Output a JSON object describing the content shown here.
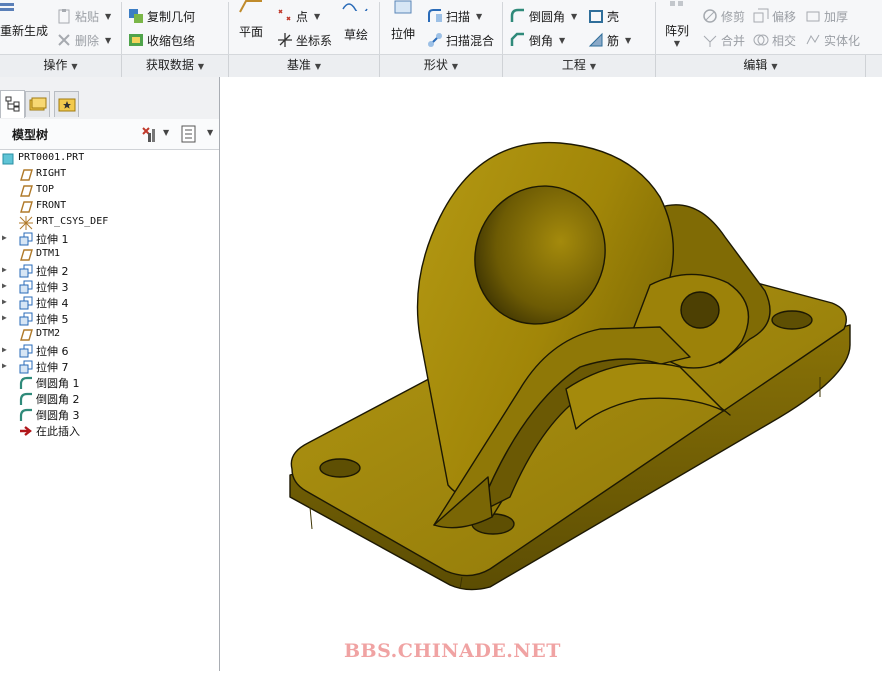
{
  "ribbon": {
    "operations": {
      "regenerate": "重新生成",
      "paste": "粘贴",
      "delete": "删除"
    },
    "getdata": {
      "copy_geom": "复制几何",
      "shrinkwrap": "收缩包络"
    },
    "datum": {
      "plane": "平面",
      "point": "点",
      "csys": "坐标系",
      "sketch": "草绘"
    },
    "shapes": {
      "extrude": "拉伸",
      "sweep": "扫描",
      "swept_blend": "扫描混合"
    },
    "engineering": {
      "round": "倒圆角",
      "shell": "壳",
      "chamfer": "倒角",
      "rib": "筋"
    },
    "editing": {
      "pattern": "阵列",
      "trim": "修剪",
      "offset": "偏移",
      "thicken": "加厚",
      "merge": "合并",
      "intersect": "相交",
      "solidify": "实体化"
    },
    "groups": [
      "操作",
      "获取数据",
      "基准",
      "形状",
      "工程",
      "编辑"
    ]
  },
  "tree": {
    "title": "模型树",
    "items": [
      {
        "label": "PRT0001.PRT",
        "icon": "part-icon",
        "indent": 0,
        "expandable": false,
        "cn": false
      },
      {
        "label": "RIGHT",
        "icon": "datum-plane-icon",
        "indent": 1,
        "expandable": false,
        "cn": false
      },
      {
        "label": "TOP",
        "icon": "datum-plane-icon",
        "indent": 1,
        "expandable": false,
        "cn": false
      },
      {
        "label": "FRONT",
        "icon": "datum-plane-icon",
        "indent": 1,
        "expandable": false,
        "cn": false
      },
      {
        "label": "PRT_CSYS_DEF",
        "icon": "csys-icon",
        "indent": 1,
        "expandable": false,
        "cn": false
      },
      {
        "label": "拉伸 1",
        "icon": "extrude-icon",
        "indent": 1,
        "expandable": true,
        "cn": true
      },
      {
        "label": "DTM1",
        "icon": "datum-plane-icon",
        "indent": 1,
        "expandable": false,
        "cn": false
      },
      {
        "label": "拉伸 2",
        "icon": "extrude-icon",
        "indent": 1,
        "expandable": true,
        "cn": true
      },
      {
        "label": "拉伸 3",
        "icon": "extrude-icon",
        "indent": 1,
        "expandable": true,
        "cn": true
      },
      {
        "label": "拉伸 4",
        "icon": "extrude-icon",
        "indent": 1,
        "expandable": true,
        "cn": true
      },
      {
        "label": "拉伸 5",
        "icon": "extrude-icon",
        "indent": 1,
        "expandable": true,
        "cn": true
      },
      {
        "label": "DTM2",
        "icon": "datum-plane-icon",
        "indent": 1,
        "expandable": false,
        "cn": false
      },
      {
        "label": "拉伸 6",
        "icon": "extrude-icon",
        "indent": 1,
        "expandable": true,
        "cn": true
      },
      {
        "label": "拉伸 7",
        "icon": "extrude-icon",
        "indent": 1,
        "expandable": true,
        "cn": true
      },
      {
        "label": "倒圆角 1",
        "icon": "round-icon",
        "indent": 1,
        "expandable": false,
        "cn": true
      },
      {
        "label": "倒圆角 2",
        "icon": "round-icon",
        "indent": 1,
        "expandable": false,
        "cn": true
      },
      {
        "label": "倒圆角 3",
        "icon": "round-icon",
        "indent": 1,
        "expandable": false,
        "cn": true
      },
      {
        "label": "在此插入",
        "icon": "insert-here-icon",
        "indent": 1,
        "expandable": false,
        "cn": true
      }
    ]
  },
  "watermark": "BBS.CHINADE.NET",
  "colors": {
    "part": "#a38a0d",
    "part_dark": "#6e5c05",
    "part_edge": "#1f1a04",
    "accent": "#2a6bb8"
  }
}
